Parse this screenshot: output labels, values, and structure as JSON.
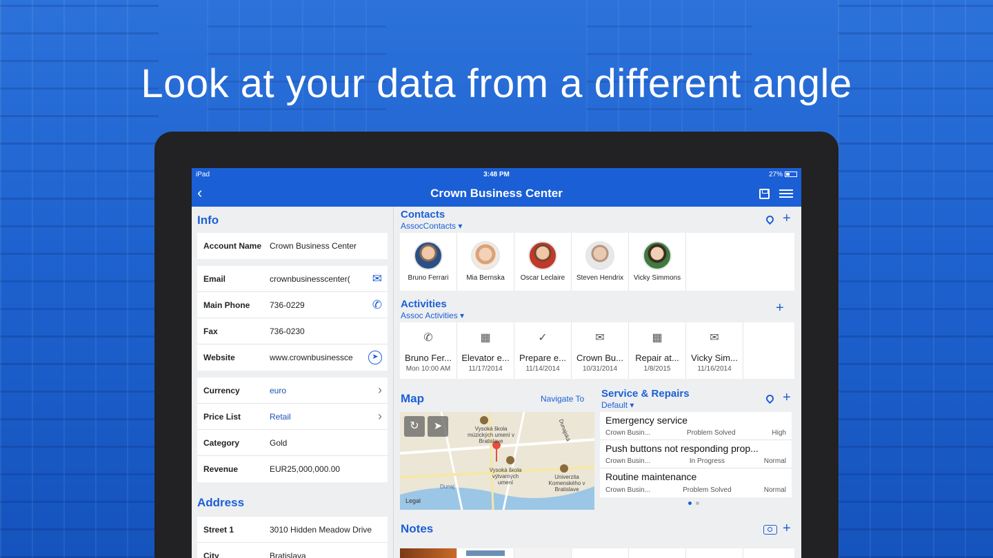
{
  "headline": "Look at your data from a different angle",
  "status_bar": {
    "device": "iPad",
    "time": "3:48 PM",
    "battery": "27%"
  },
  "nav": {
    "title": "Crown Business Center"
  },
  "info": {
    "heading": "Info",
    "account": {
      "label": "Account Name",
      "value": "Crown Business Center"
    },
    "contact_rows": [
      {
        "label": "Email",
        "value": "crownbusinesscenter(",
        "icon": "mail-icon"
      },
      {
        "label": "Main Phone",
        "value": "736-0229",
        "icon": "phone-icon"
      },
      {
        "label": "Fax",
        "value": "736-0230"
      },
      {
        "label": "Website",
        "value": "www.crownbusinessce",
        "icon": "compass-icon"
      }
    ],
    "detail_rows": [
      {
        "label": "Currency",
        "value": "euro",
        "link": true
      },
      {
        "label": "Price List",
        "value": "Retail",
        "link": true
      },
      {
        "label": "Category",
        "value": "Gold"
      },
      {
        "label": "Revenue",
        "value": "EUR25,000,000.00"
      }
    ]
  },
  "address": {
    "heading": "Address",
    "rows": [
      {
        "label": "Street 1",
        "value": "3010 Hidden Meadow Drive"
      },
      {
        "label": "City",
        "value": "Bratislava"
      }
    ]
  },
  "contacts": {
    "heading": "Contacts",
    "filter": "AssocContacts",
    "people": [
      {
        "name": "Bruno Ferrari",
        "color": "#8a6a4f"
      },
      {
        "name": "Mia Bernska",
        "color": "#d9a27a"
      },
      {
        "name": "Oscar Leclaire",
        "color": "#c0392b"
      },
      {
        "name": "Steven Hendrix",
        "color": "#b39580"
      },
      {
        "name": "Vicky Simmons",
        "color": "#3f7a3f"
      }
    ]
  },
  "activities": {
    "heading": "Activities",
    "filter": "Assoc Activities",
    "items": [
      {
        "icon": "phone-icon",
        "glyph": "✆",
        "title": "Bruno Fer...",
        "date": "Mon 10:00 AM"
      },
      {
        "icon": "calendar-icon",
        "glyph": "▦",
        "title": "Elevator e...",
        "date": "11/17/2014"
      },
      {
        "icon": "check-icon",
        "glyph": "✓",
        "title": "Prepare e...",
        "date": "11/14/2014"
      },
      {
        "icon": "mail-icon",
        "glyph": "✉",
        "title": "Crown Bu...",
        "date": "10/31/2014"
      },
      {
        "icon": "calendar-icon",
        "glyph": "▦",
        "title": "Repair at...",
        "date": "1/8/2015"
      },
      {
        "icon": "mail-icon",
        "glyph": "✉",
        "title": "Vicky Sim...",
        "date": "11/16/2014"
      }
    ]
  },
  "map": {
    "heading": "Map",
    "navigate": "Navigate To",
    "labels": [
      "Vysoká škola múzických umení v Bratislave",
      "Vysoká škola výtvarných umení",
      "Univerzita Komenského v Bratislave",
      "Dunaj",
      "Dunajská",
      "Legal"
    ]
  },
  "service": {
    "heading": "Service & Repairs",
    "filter": "Default",
    "items": [
      {
        "title": "Emergency service",
        "account": "Crown Busin...",
        "status": "Problem Solved",
        "priority": "High"
      },
      {
        "title": "Push buttons not responding prop...",
        "account": "Crown Busin...",
        "status": "In Progress",
        "priority": "Normal"
      },
      {
        "title": "Routine maintenance",
        "account": "Crown Busin...",
        "status": "Problem Solved",
        "priority": "Normal"
      }
    ]
  },
  "notes": {
    "heading": "Notes"
  }
}
